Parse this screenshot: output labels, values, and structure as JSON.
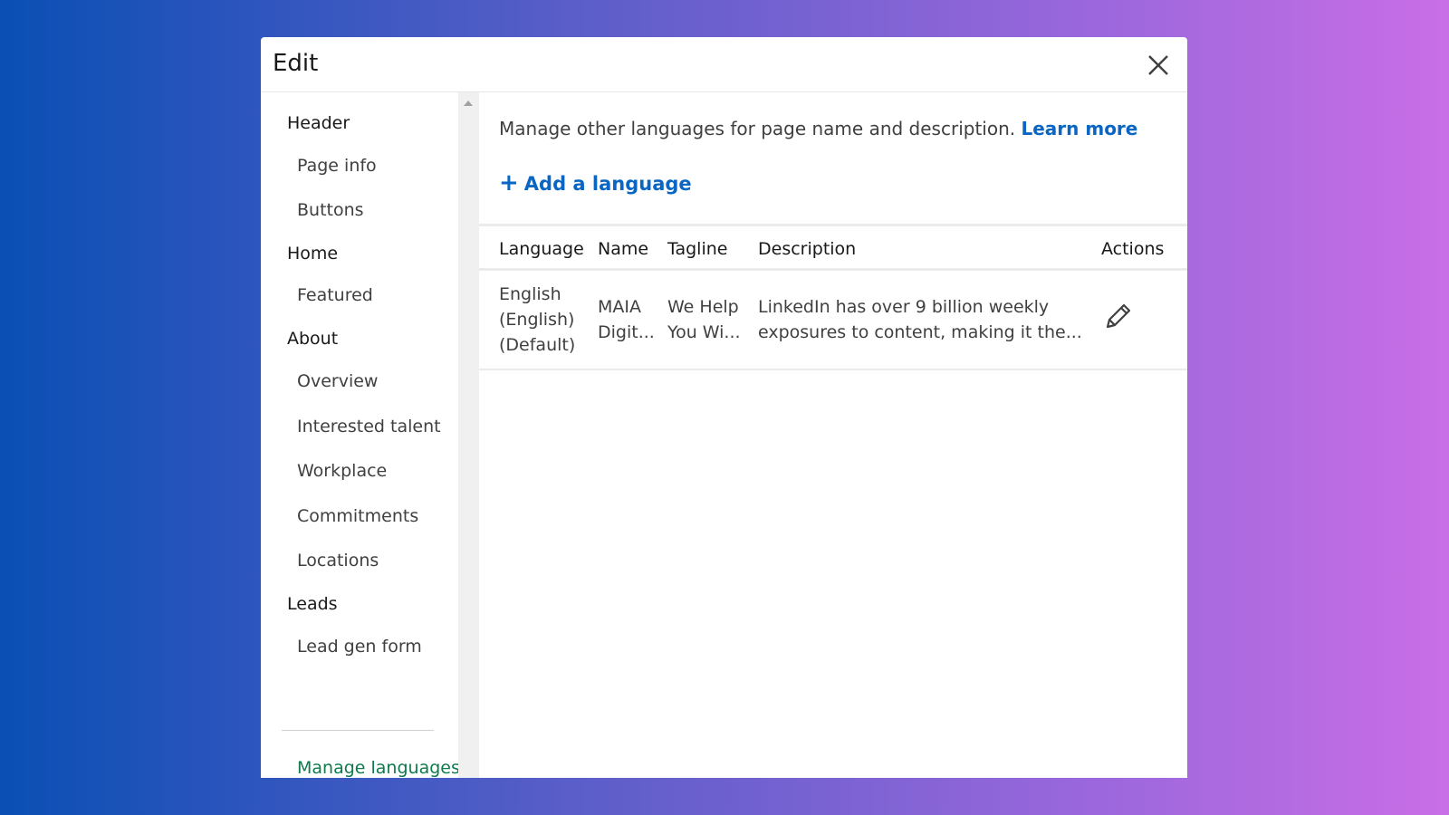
{
  "modal": {
    "title": "Edit"
  },
  "sidebar": {
    "items": [
      {
        "label": "Header",
        "kind": "section"
      },
      {
        "label": "Page info",
        "kind": "sub"
      },
      {
        "label": "Buttons",
        "kind": "sub"
      },
      {
        "label": "Home",
        "kind": "section"
      },
      {
        "label": "Featured",
        "kind": "sub"
      },
      {
        "label": "About",
        "kind": "section"
      },
      {
        "label": "Overview",
        "kind": "sub"
      },
      {
        "label": "Interested talent",
        "kind": "sub"
      },
      {
        "label": "Workplace",
        "kind": "sub"
      },
      {
        "label": "Commitments",
        "kind": "sub"
      },
      {
        "label": "Locations",
        "kind": "sub"
      },
      {
        "label": "Leads",
        "kind": "section"
      },
      {
        "label": "Lead gen form",
        "kind": "sub"
      }
    ],
    "active_item": "Manage languages"
  },
  "main": {
    "intro_text": "Manage other languages for page name and description.",
    "learn_more": "Learn more",
    "add_language": "Add a language",
    "table": {
      "headers": {
        "language": "Language",
        "name": "Name",
        "tagline": "Tagline",
        "description": "Description",
        "actions": "Actions"
      },
      "rows": [
        {
          "language_line1": "English",
          "language_line2": "(English)",
          "language_line3": "(Default)",
          "name_line1": "MAIA",
          "name_line2": "Digit...",
          "tagline_line1": "We Help",
          "tagline_line2": "You Wi...",
          "description_line1": "LinkedIn has over 9 billion weekly",
          "description_line2": "exposures to content, making it the..."
        }
      ]
    }
  },
  "icons": {
    "close": "close-icon",
    "edit": "pencil-icon",
    "add": "plus-icon"
  },
  "colors": {
    "link": "#0a66c2",
    "active_nav": "#0e7a4d"
  }
}
